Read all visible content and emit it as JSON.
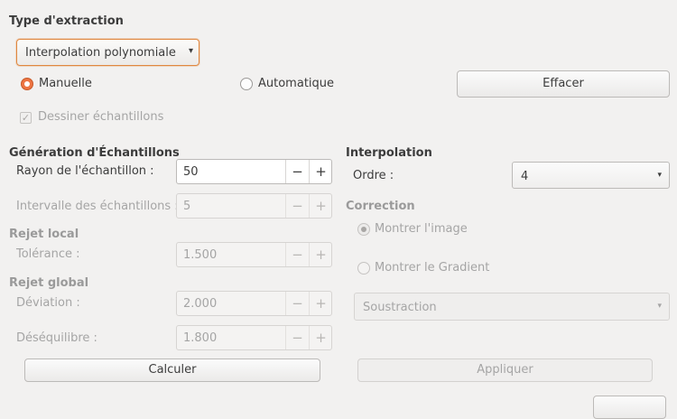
{
  "extraction": {
    "heading": "Type d'extraction",
    "method": "Interpolation polynomiale",
    "radio_manual": "Manuelle",
    "radio_auto": "Automatique",
    "clear_button": "Effacer",
    "draw_samples": "Dessiner échantillons"
  },
  "sample_generation": {
    "heading": "Génération d'Échantillons",
    "radius_label": "Rayon de l'échantillon :",
    "radius_value": "50",
    "interval_label": "Intervalle des échantillons :",
    "interval_value": "5"
  },
  "local_rejection": {
    "heading": "Rejet local",
    "tolerance_label": "Tolérance :",
    "tolerance_value": "1.500"
  },
  "global_rejection": {
    "heading": "Rejet global",
    "deviation_label": "Déviation :",
    "deviation_value": "2.000",
    "imbalance_label": "Déséquilibre :",
    "imbalance_value": "1.800"
  },
  "interpolation": {
    "heading": "Interpolation",
    "order_label": "Ordre :",
    "order_value": "4"
  },
  "correction": {
    "heading": "Correction",
    "show_image": "Montrer l'image",
    "show_gradient": "Montrer le Gradient",
    "mode": "Soustraction"
  },
  "actions": {
    "compute": "Calculer",
    "apply": "Appliquer"
  },
  "icons": {
    "dropdown": "▾",
    "minus": "−",
    "plus": "+",
    "check": "✓"
  }
}
